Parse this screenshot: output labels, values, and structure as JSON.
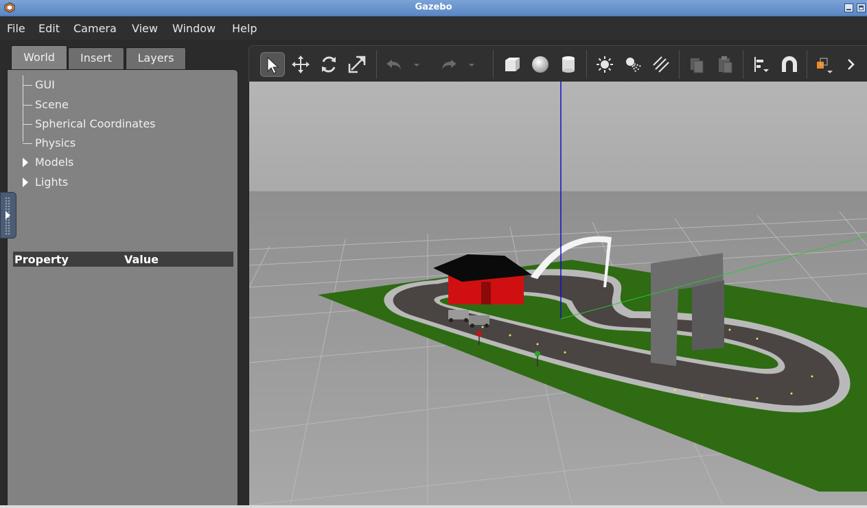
{
  "window": {
    "title": "Gazebo"
  },
  "menubar": {
    "items": [
      "File",
      "Edit",
      "Camera",
      "View",
      "Window",
      "Help"
    ]
  },
  "left_panel": {
    "tabs": [
      {
        "label": "World",
        "active": true
      },
      {
        "label": "Insert",
        "active": false
      },
      {
        "label": "Layers",
        "active": false
      }
    ],
    "tree": [
      {
        "label": "GUI",
        "expandable": false
      },
      {
        "label": "Scene",
        "expandable": false
      },
      {
        "label": "Spherical Coordinates",
        "expandable": false
      },
      {
        "label": "Physics",
        "expandable": false
      },
      {
        "label": "Models",
        "expandable": true
      },
      {
        "label": "Lights",
        "expandable": true
      }
    ],
    "properties": {
      "col_property": "Property",
      "col_value": "Value"
    }
  },
  "toolbar": {
    "tools": [
      {
        "name": "select-mode-icon",
        "active": true
      },
      {
        "name": "translate-mode-icon"
      },
      {
        "name": "rotate-mode-icon"
      },
      {
        "name": "scale-mode-icon"
      },
      {
        "name": "undo-icon"
      },
      {
        "name": "undo-history-dropdown-icon"
      },
      {
        "name": "redo-icon"
      },
      {
        "name": "redo-history-dropdown-icon"
      },
      {
        "name": "box-shape-icon"
      },
      {
        "name": "sphere-shape-icon"
      },
      {
        "name": "cylinder-shape-icon"
      },
      {
        "name": "point-light-icon"
      },
      {
        "name": "spot-light-icon"
      },
      {
        "name": "directional-light-icon"
      },
      {
        "name": "copy-icon"
      },
      {
        "name": "paste-icon"
      },
      {
        "name": "align-icon"
      },
      {
        "name": "snap-magnet-icon"
      },
      {
        "name": "view-angle-icon"
      },
      {
        "name": "more-tools-chevron-icon"
      }
    ]
  },
  "scene": {
    "sky_color": "#b3b3b3",
    "ground_color": "#9d9d9d",
    "grass_color": "#2e6b12",
    "road_color": "#4a4442",
    "road_edge_color": "#b9b9b9",
    "z_axis_color": "#1010c8",
    "y_axis_color": "#2fc43a"
  }
}
